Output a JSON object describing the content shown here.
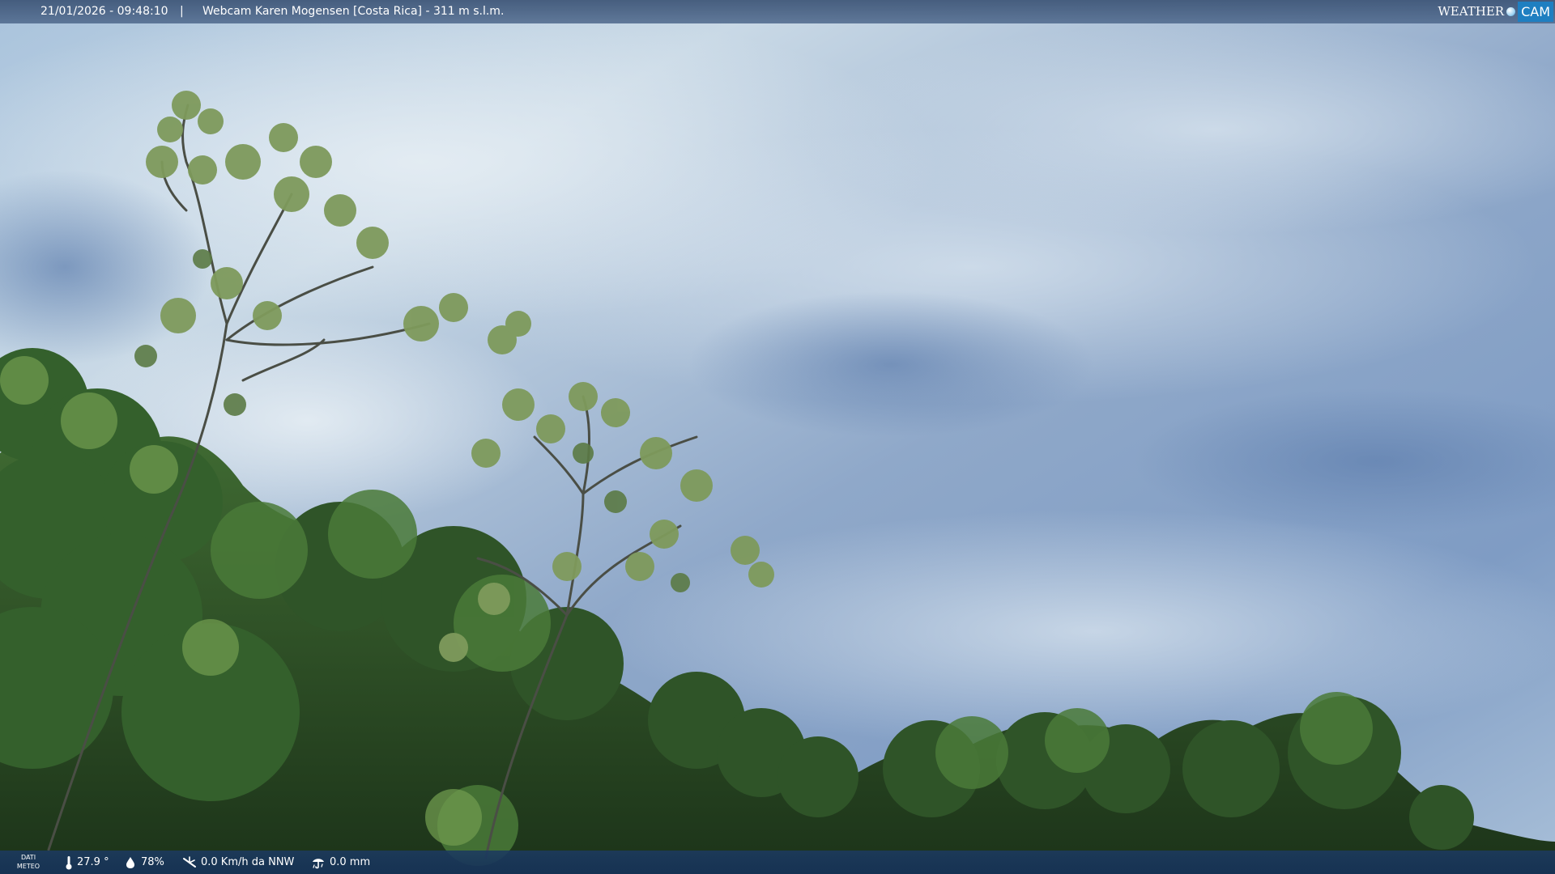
{
  "overlay": {
    "timestamp": "21/01/2026 - 09:48:10",
    "separator": "|",
    "title": "Webcam Karen Mogensen [Costa Rica] - 311 m s.l.m."
  },
  "brand": {
    "word": "WEATHER",
    "cam": "CAM"
  },
  "weather": {
    "label_line1": "DATI",
    "label_line2": "METEO",
    "temperature": "27.9 °",
    "humidity": "78%",
    "wind": "0.0 Km/h da NNW",
    "rain": "0.0 mm",
    "icons": [
      "thermometer-icon",
      "humidity-drop-icon",
      "wind-icon",
      "rain-icon"
    ]
  },
  "colors": {
    "bar_top": "#3c5476",
    "bar_bottom": "#1c3a60",
    "brand_blue": "#1f7fc1"
  }
}
